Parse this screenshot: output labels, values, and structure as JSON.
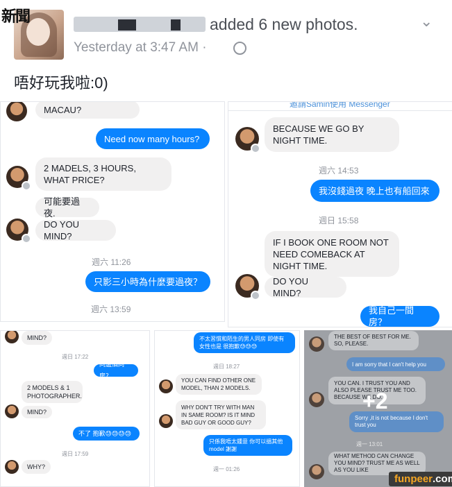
{
  "post": {
    "site_logo": "新聞",
    "added_text": "added 6 new photos.",
    "timestamp": "Yesterday at 3:47 AM",
    "caption": "唔好玩我啦:0)"
  },
  "photo1": {
    "messages": [
      {
        "side": "in",
        "text": "MACAU?"
      },
      {
        "side": "out",
        "text": "Need now many hours?"
      },
      {
        "side": "in",
        "text": "2 MADELS, 3 HOURS, WHAT PRICE?"
      },
      {
        "side": "in",
        "text": "可能要過夜."
      },
      {
        "side": "in",
        "text": "DO YOU MIND?"
      },
      {
        "side": "ts",
        "text": "週六 11:26"
      },
      {
        "side": "out",
        "text": "只影三小時為什麼要過夜？"
      },
      {
        "side": "ts",
        "text": "週六 13:59"
      }
    ]
  },
  "photo2": {
    "header": "邀請Samin使用 Messenger",
    "messages": [
      {
        "side": "in",
        "text": "BECAUSE WE GO BY NIGHT TIME."
      },
      {
        "side": "ts",
        "text": "週六 14:53"
      },
      {
        "side": "out",
        "text": "我沒錢過夜 晚上也有船回來"
      },
      {
        "side": "ts",
        "text": "週日 15:58"
      },
      {
        "side": "in",
        "text": "IF I BOOK ONE ROOM NOT NEED COMEBACK AT NIGHT TIME."
      },
      {
        "side": "in",
        "text": "DO YOU MIND?"
      },
      {
        "side": "out",
        "text": "我自己一間房？"
      }
    ]
  },
  "photo3": {
    "messages": [
      {
        "side": "in",
        "text": "MIND?"
      },
      {
        "side": "ts",
        "text": "週日 17:22"
      },
      {
        "side": "out",
        "text": "同邊個同房？"
      },
      {
        "side": "in",
        "text": "2 MODELS & 1 PHOTOGRAPHER."
      },
      {
        "side": "in",
        "text": "MIND?"
      },
      {
        "side": "out",
        "text": "不了 抱歉😓😓😓😓"
      },
      {
        "side": "ts",
        "text": "週日 17:59"
      },
      {
        "side": "in",
        "text": "WHY?"
      }
    ]
  },
  "photo4": {
    "messages": [
      {
        "side": "out",
        "text": "不太習慣和陌生的男人同房 即使有女性也是 很抱歉😓😓😓"
      },
      {
        "side": "ts",
        "text": "週日 18:27"
      },
      {
        "side": "in",
        "text": "YOU CAN FIND OTHER ONE MODEL, THAN 2 MODELS."
      },
      {
        "side": "in",
        "text": "WHY DON'T TRY WITH MAN IN SAME ROOM? IS IT MIND BAD GUY OR GOOD GUY?"
      },
      {
        "side": "out",
        "text": "只係我唔太鍾意 你可以搵其他model 謝謝"
      },
      {
        "side": "ts",
        "text": "週一 01:26"
      }
    ]
  },
  "photo5": {
    "more_count": "+2",
    "messages": [
      {
        "side": "in",
        "text": "THE BEST OF BEST FOR ME. SO, PLEASE."
      },
      {
        "side": "out",
        "text": "I am sorry that I can't help you"
      },
      {
        "side": "in",
        "text": "YOU CAN. I TRUST YOU AND ALSO PLEASE TRUST ME TOO. BECAUSE WE DO."
      },
      {
        "side": "out",
        "text": "Sorry ,it is not because I don't trust you"
      },
      {
        "side": "ts",
        "text": "週一 13:01"
      },
      {
        "side": "in",
        "text": "WHAT METHOD CAN CHANGE YOU MIND? TRUST ME AS WELL AS YOU LIKE"
      }
    ]
  },
  "watermark": {
    "brand": "funpeer",
    "suffix": ".com"
  },
  "colors": {
    "messenger_blue": "#0a84ff",
    "incoming_gray": "#f1f0f0",
    "meta_gray": "#90949c"
  }
}
